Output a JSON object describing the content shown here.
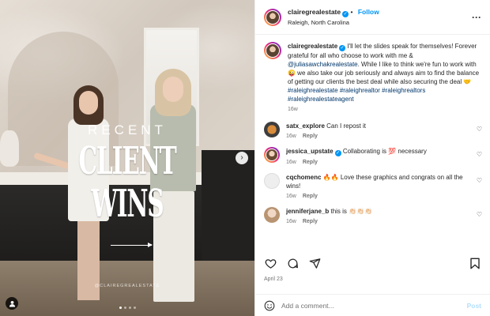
{
  "post": {
    "username": "clairegrealestate",
    "follow_label": "Follow",
    "location": "Raleigh, North Carolina",
    "more_icon": "more-horizontal-icon",
    "date": "April 23"
  },
  "media": {
    "overlay_small": "RECENT",
    "overlay_big_1": "CLIENT",
    "overlay_big_2": "WINS",
    "watermark": "@CLAIREGREALESTATE",
    "carousel_dots": 4,
    "active_dot": 0
  },
  "caption": {
    "username": "clairegrealestate",
    "text_1": " I'll let the slides speak for themselves! Forever grateful for all who choose to work with me & ",
    "mention": "@juliasawchakrealestate",
    "text_2": ". While I like to think we're fun to work with 😜 we also take our job seriously and always aim to find the balance of getting our clients the best deal while also securing the deal 🤝 ",
    "hashtags": "#raleighrealestate #raleighrealtor #raleighrealtors #raleighrealestateagent",
    "time": "16w"
  },
  "comments": [
    {
      "username": "satx_explore",
      "text": "Can I repost it",
      "time": "16w",
      "reply": "Reply",
      "verified": false
    },
    {
      "username": "jessica_upstate",
      "text": "Collaborating is 💯 necessary",
      "time": "16w",
      "reply": "Reply",
      "verified": true
    },
    {
      "username": "cqchomenc",
      "text": "🔥🔥 Love these graphics and congrats on all the wins!",
      "time": "16w",
      "reply": "Reply",
      "verified": false
    },
    {
      "username": "jenniferjane_b",
      "text": "this is 👏🏻👏🏻👏🏻",
      "time": "16w",
      "reply": "Reply",
      "verified": false
    }
  ],
  "add_comment": {
    "placeholder": "Add a comment...",
    "post_label": "Post"
  },
  "colors": {
    "accent": "#0095f6",
    "link": "#00376b",
    "muted": "#737373"
  }
}
